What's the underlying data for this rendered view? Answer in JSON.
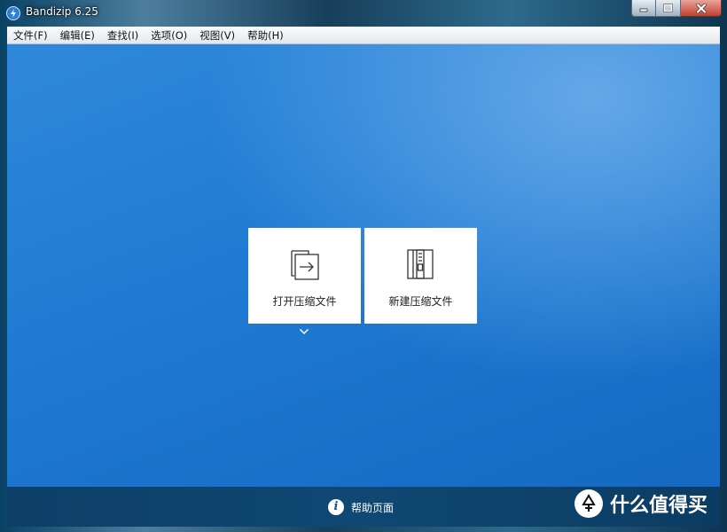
{
  "window": {
    "title": "Bandizip 6.25"
  },
  "menu": {
    "items": [
      {
        "label": "文件(F)"
      },
      {
        "label": "编辑(E)"
      },
      {
        "label": "查找(I)"
      },
      {
        "label": "选项(O)"
      },
      {
        "label": "视图(V)"
      },
      {
        "label": "帮助(H)"
      }
    ]
  },
  "actions": {
    "open_archive": {
      "label": "打开压缩文件",
      "icon": "open-archive-icon"
    },
    "new_archive": {
      "label": "新建压缩文件",
      "icon": "new-archive-icon"
    },
    "dropdown_icon": "chevron-down-icon"
  },
  "footer": {
    "help_label": "帮助页面",
    "help_icon": "info-icon"
  },
  "watermark": {
    "text": "什么值得买",
    "icon": "zhi-logo-icon"
  },
  "colors": {
    "content_background": "#1f7ad3",
    "footer_background": "#0f4873",
    "card_background": "#ffffff",
    "close_button": "#c4402f"
  }
}
